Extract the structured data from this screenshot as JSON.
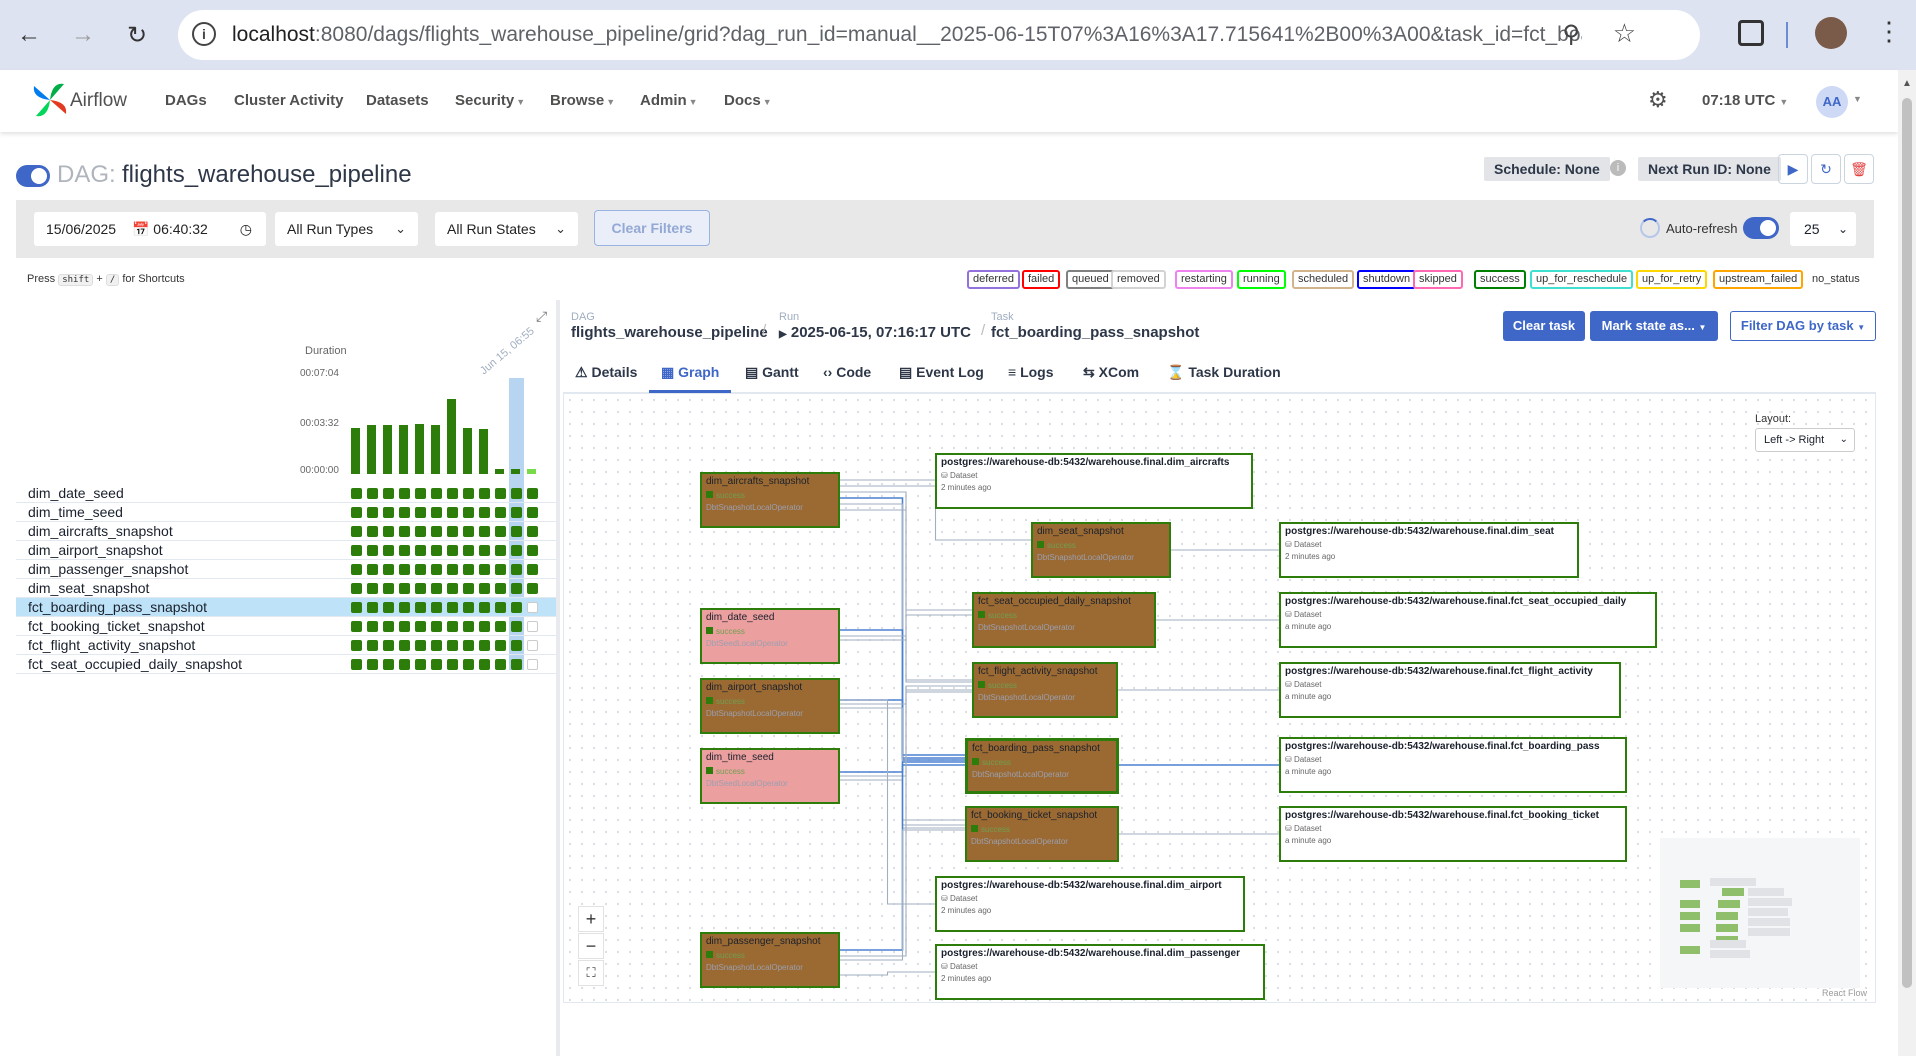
{
  "browser": {
    "url_host": "localhost",
    "url_rest": ":8080/dags/flights_warehouse_pipeline/grid?dag_run_id=manual__2025-06-15T07%3A16%3A17.715641%2B00%3A00&task_id=fct_boar..."
  },
  "nav": {
    "logo_text": "Airflow",
    "items": [
      "DAGs",
      "Cluster Activity",
      "Datasets",
      "Security",
      "Browse",
      "Admin",
      "Docs"
    ],
    "time": "07:18 UTC",
    "avatar": "AA"
  },
  "dag": {
    "label": "DAG:",
    "name": "flights_warehouse_pipeline",
    "schedule": "Schedule: None",
    "next_run": "Next Run ID: None"
  },
  "filters": {
    "date": "15/06/2025",
    "time": "06:40:32",
    "run_types": "All Run Types",
    "run_states": "All Run States",
    "clear": "Clear Filters",
    "auto_refresh": "Auto-refresh",
    "count": "25"
  },
  "shortcut": {
    "press": "Press",
    "key1": "shift",
    "plus": "+",
    "key2": "/",
    "suffix": "for Shortcuts"
  },
  "legend": [
    {
      "label": "deferred",
      "color": "#9370db"
    },
    {
      "label": "failed",
      "color": "#ff0000"
    },
    {
      "label": "queued",
      "color": "#808080"
    },
    {
      "label": "removed",
      "color": "#d3d3d3"
    },
    {
      "label": "restarting",
      "color": "#ee82ee"
    },
    {
      "label": "running",
      "color": "#00ff00"
    },
    {
      "label": "scheduled",
      "color": "#d2b48c"
    },
    {
      "label": "shutdown",
      "color": "#0000ff"
    },
    {
      "label": "skipped",
      "color": "#ff69b4"
    },
    {
      "label": "success",
      "color": "#008000"
    },
    {
      "label": "up_for_reschedule",
      "color": "#40e0d0"
    },
    {
      "label": "up_for_retry",
      "color": "#ffd700"
    },
    {
      "label": "upstream_failed",
      "color": "#ffa500"
    },
    {
      "label": "no_status",
      "color": ""
    }
  ],
  "grid": {
    "duration_label": "Duration",
    "ticks": [
      "00:07:04",
      "00:03:32",
      "00:00:00"
    ],
    "date_label": "Jun 15, 06:55",
    "durations_sec": [
      205,
      215,
      215,
      215,
      220,
      215,
      332,
      205,
      200,
      20,
      20,
      20
    ],
    "tasks": [
      "dim_date_seed",
      "dim_time_seed",
      "dim_aircrafts_snapshot",
      "dim_airport_snapshot",
      "dim_passenger_snapshot",
      "dim_seat_snapshot",
      "fct_boarding_pass_snapshot",
      "fct_booking_ticket_snapshot",
      "fct_flight_activity_snapshot",
      "fct_seat_occupied_daily_snapshot"
    ],
    "selected_task": "fct_boarding_pass_snapshot"
  },
  "details": {
    "crumb_dag_label": "DAG",
    "crumb_dag": "flights_warehouse_pipeline",
    "crumb_run_label": "Run",
    "crumb_run": "2025-06-15, 07:16:17 UTC",
    "crumb_task_label": "Task",
    "crumb_task": "fct_boarding_pass_snapshot",
    "clear_task": "Clear task",
    "mark_state": "Mark state as...",
    "filter_dag": "Filter DAG by task",
    "tabs": [
      "Details",
      "Graph",
      "Gantt",
      "Code",
      "Event Log",
      "Logs",
      "XCom",
      "Task Duration"
    ]
  },
  "graph": {
    "layout_label": "Layout:",
    "layout_value": "Left -> Right",
    "tasks": [
      {
        "id": "dim_aircrafts_snapshot",
        "state": "success",
        "op": "DbtSnapshotLocalOperator",
        "kind": "task"
      },
      {
        "id": "dim_seat_snapshot",
        "state": "success",
        "op": "DbtSnapshotLocalOperator",
        "kind": "task"
      },
      {
        "id": "dim_date_seed",
        "state": "success",
        "op": "DbtSeedLocalOperator",
        "kind": "seed"
      },
      {
        "id": "fct_seat_occupied_daily_snapshot",
        "state": "success",
        "op": "DbtSnapshotLocalOperator",
        "kind": "task"
      },
      {
        "id": "dim_airport_snapshot",
        "state": "success",
        "op": "DbtSnapshotLocalOperator",
        "kind": "task"
      },
      {
        "id": "fct_flight_activity_snapshot",
        "state": "success",
        "op": "DbtSnapshotLocalOperator",
        "kind": "task"
      },
      {
        "id": "dim_time_seed",
        "state": "success",
        "op": "DbtSeedLocalOperator",
        "kind": "seed"
      },
      {
        "id": "fct_boarding_pass_snapshot",
        "state": "success",
        "op": "DbtSnapshotLocalOperator",
        "kind": "task"
      },
      {
        "id": "fct_booking_ticket_snapshot",
        "state": "success",
        "op": "DbtSnapshotLocalOperator",
        "kind": "task"
      },
      {
        "id": "dim_passenger_snapshot",
        "state": "success",
        "op": "DbtSnapshotLocalOperator",
        "kind": "task"
      }
    ],
    "datasets": [
      {
        "uri": "postgres://warehouse-db:5432/warehouse.final.dim_aircrafts",
        "kind": "Dataset",
        "when": "2 minutes ago"
      },
      {
        "uri": "postgres://warehouse-db:5432/warehouse.final.dim_seat",
        "kind": "Dataset",
        "when": "2 minutes ago"
      },
      {
        "uri": "postgres://warehouse-db:5432/warehouse.final.fct_seat_occupied_daily",
        "kind": "Dataset",
        "when": "a minute ago"
      },
      {
        "uri": "postgres://warehouse-db:5432/warehouse.final.fct_flight_activity",
        "kind": "Dataset",
        "when": "a minute ago"
      },
      {
        "uri": "postgres://warehouse-db:5432/warehouse.final.fct_boarding_pass",
        "kind": "Dataset",
        "when": "a minute ago"
      },
      {
        "uri": "postgres://warehouse-db:5432/warehouse.final.fct_booking_ticket",
        "kind": "Dataset",
        "when": "a minute ago"
      },
      {
        "uri": "postgres://warehouse-db:5432/warehouse.final.dim_airport",
        "kind": "Dataset",
        "when": "2 minutes ago"
      },
      {
        "uri": "postgres://warehouse-db:5432/warehouse.final.dim_passenger",
        "kind": "Dataset",
        "when": "2 minutes ago"
      }
    ],
    "zoom_in": "+",
    "zoom_out": "−",
    "fit": "⛶",
    "attribution": "React Flow"
  },
  "colors": {
    "accent": "#3f67c7",
    "success": "#2d7d0a",
    "task_node": "#9b6a33",
    "seed_node": "#ec9f9f"
  }
}
